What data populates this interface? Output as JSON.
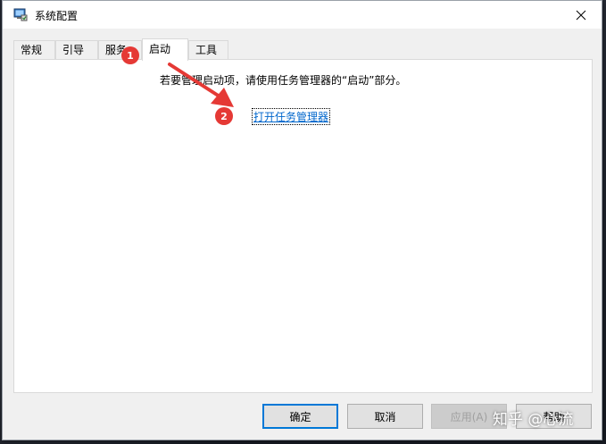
{
  "window": {
    "title": "系统配置",
    "close_icon": "close-icon"
  },
  "tabs": [
    {
      "label": "常规",
      "active": false
    },
    {
      "label": "引导",
      "active": false
    },
    {
      "label": "服务",
      "active": false
    },
    {
      "label": "启动",
      "active": true
    },
    {
      "label": "工具",
      "active": false
    }
  ],
  "startup_panel": {
    "info_text": "若要管理启动项，请使用任务管理器的“启动”部分。",
    "link_text": "打开任务管理器"
  },
  "buttons": {
    "ok": "确定",
    "cancel": "取消",
    "apply": "应用(A)",
    "help": "帮助"
  },
  "annotations": {
    "step1": "1",
    "step2": "2",
    "color": "#e53935"
  },
  "watermark": "知乎 @心流"
}
